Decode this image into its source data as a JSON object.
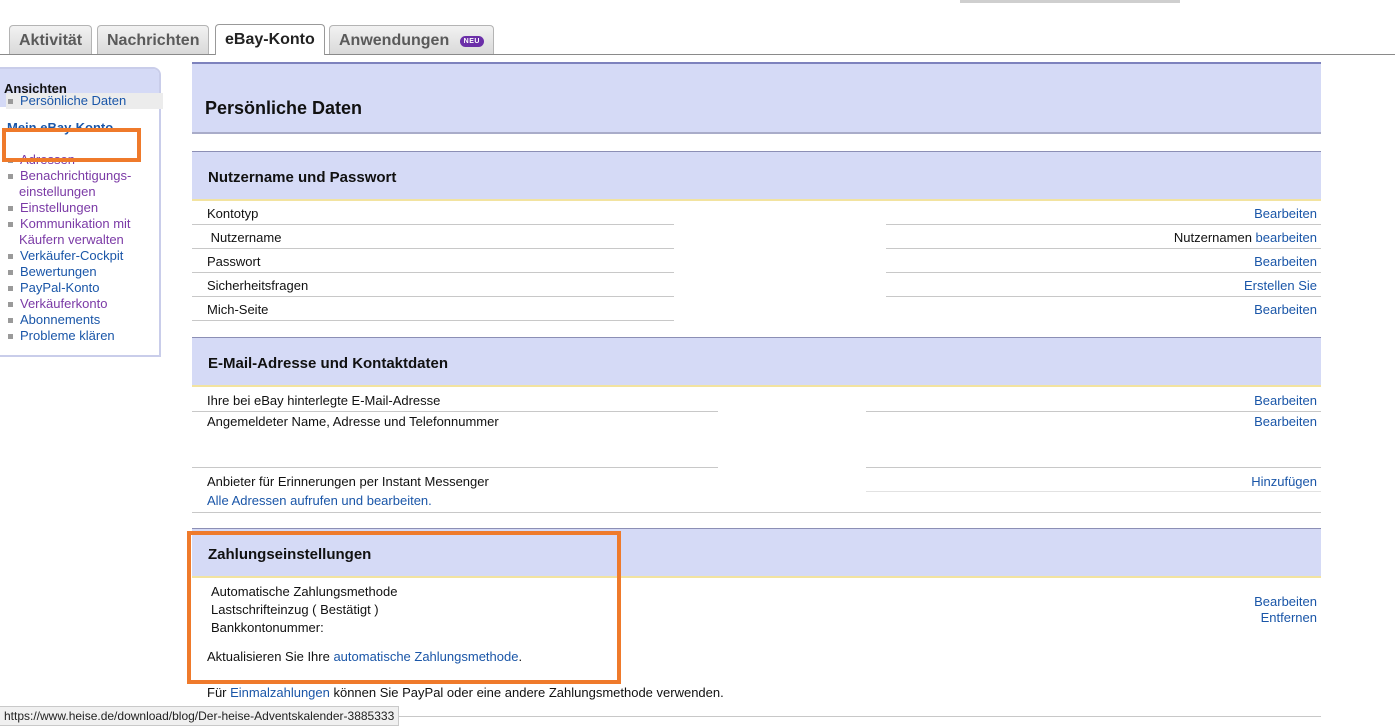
{
  "tabs": {
    "activity": "Aktivität",
    "messages": "Nachrichten",
    "account": "eBay-Konto",
    "apps": "Anwendungen",
    "apps_badge": "NEU"
  },
  "sidebar": {
    "header": "Ansichten",
    "title": "Mein eBay-Konto",
    "items": [
      {
        "label": "Persönliche Daten"
      },
      {
        "label": "Adressen"
      },
      {
        "label": "Benachrichtigungs-einstellungen",
        "line1": "Benachrichtigungs-",
        "line2": "einstellungen"
      },
      {
        "label": "Einstellungen"
      },
      {
        "label": "Kommunikation mit Käufern verwalten",
        "line1": "Kommunikation mit",
        "line2": "Käufern verwalten"
      },
      {
        "label": "Verkäufer-Cockpit"
      },
      {
        "label": "Bewertungen"
      },
      {
        "label": "PayPal-Konto"
      },
      {
        "label": "Verkäuferkonto"
      },
      {
        "label": "Abonnements"
      },
      {
        "label": "Probleme klären"
      }
    ]
  },
  "page": {
    "title": "Persönliche Daten"
  },
  "account_section": {
    "title": "Nutzername und Passwort",
    "rows": [
      {
        "label": "Kontotyp",
        "action": "Bearbeiten"
      },
      {
        "label": " Nutzername",
        "prefix": "Nutzernamen ",
        "action": "bearbeiten"
      },
      {
        "label": "Passwort",
        "action": "Bearbeiten"
      },
      {
        "label": "Sicherheitsfragen",
        "action": "Erstellen Sie"
      },
      {
        "label": "Mich-Seite",
        "action": "Bearbeiten"
      }
    ]
  },
  "contact_section": {
    "title": "E-Mail-Adresse und Kontaktdaten",
    "rows": [
      {
        "label": "Ihre bei eBay hinterlegte E-Mail-Adresse",
        "action": "Bearbeiten"
      },
      {
        "label": "Angemeldeter Name, Adresse und Telefonnummer",
        "action": "Bearbeiten"
      },
      {
        "label": "Anbieter für Erinnerungen per Instant Messenger",
        "action": "Hinzufügen"
      }
    ],
    "all_addresses_link": "Alle Adressen aufrufen und bearbeiten."
  },
  "payment_section": {
    "title": "Zahlungseinstellungen",
    "method_label": "Automatische Zahlungsmethode",
    "method_value": "Lastschrifteinzug ( Bestätigt )",
    "bank_label": "Bankkontonummer:",
    "edit": "Bearbeiten",
    "remove": "Entfernen",
    "update_prefix": "Aktualisieren Sie Ihre ",
    "update_link": "automatische Zahlungsmethode",
    "update_suffix": ".",
    "single_prefix": "Für ",
    "single_link": "Einmalzahlungen",
    "single_suffix": " können Sie PayPal oder eine andere Zahlungsmethode verwenden."
  },
  "statusbar": {
    "url": "https://www.heise.de/download/blog/Der-heise-Adventskalender-3885333"
  },
  "colors": {
    "section_bg": "#d5daf6",
    "link": "#1a56a8",
    "visited_link": "#7b3aa6",
    "highlight": "#ef7a2b"
  }
}
